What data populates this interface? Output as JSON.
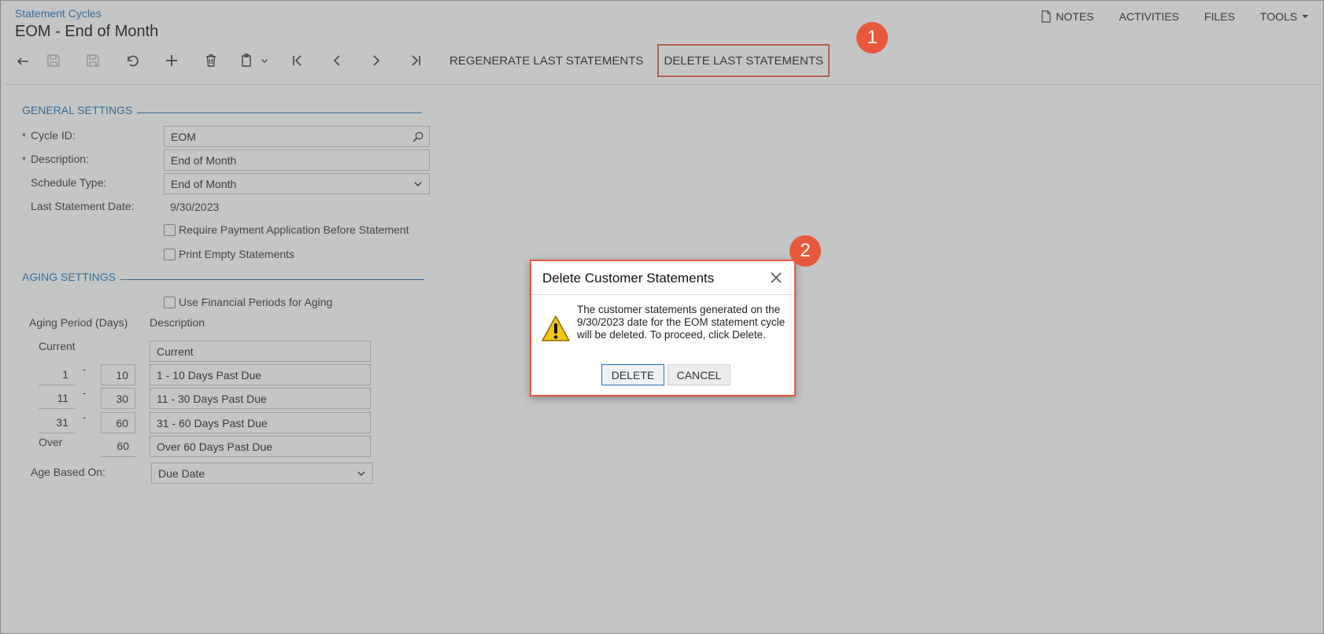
{
  "header": {
    "breadcrumb": "Statement Cycles",
    "title": "EOM - End of Month",
    "links": {
      "notes": "NOTES",
      "activities": "ACTIVITIES",
      "files": "FILES",
      "tools": "TOOLS"
    }
  },
  "toolbar": {
    "regenerate_label": "REGENERATE LAST STATEMENTS",
    "delete_label": "DELETE LAST STATEMENTS",
    "icons": [
      "back-icon",
      "save-close-icon",
      "save-icon",
      "undo-icon",
      "add-icon",
      "delete-icon",
      "copy-paste-icon",
      "first-icon",
      "previous-icon",
      "next-icon",
      "last-icon"
    ]
  },
  "callouts": {
    "one": "1",
    "two": "2",
    "color": "#e8583d"
  },
  "general": {
    "heading": "GENERAL SETTINGS",
    "cycle_id_label": "Cycle ID:",
    "cycle_id_value": "EOM",
    "description_label": "Description:",
    "description_value": "End of Month",
    "schedule_type_label": "Schedule Type:",
    "schedule_type_value": "End of Month",
    "last_statement_label": "Last Statement Date:",
    "last_statement_value": "9/30/2023",
    "require_payment_label": "Require Payment Application Before Statement",
    "print_empty_label": "Print Empty Statements",
    "required_mark": "*"
  },
  "aging": {
    "heading": "AGING SETTINGS",
    "use_fin_periods_label": "Use Financial Periods for Aging",
    "col_period": "Aging Period (Days)",
    "col_description": "Description",
    "dash": "-",
    "rows": [
      {
        "from": "Current",
        "to": "",
        "description": "Current"
      },
      {
        "from": "1",
        "to": "10",
        "description": "1 - 10 Days Past Due"
      },
      {
        "from": "11",
        "to": "30",
        "description": "11 - 30 Days Past Due"
      },
      {
        "from": "31",
        "to": "60",
        "description": "31 - 60 Days Past Due"
      },
      {
        "from": "Over",
        "to": "60",
        "description": "Over 60 Days Past Due"
      }
    ],
    "age_based_label": "Age Based On:",
    "age_based_value": "Due Date"
  },
  "dialog": {
    "title": "Delete Customer Statements",
    "message": "The customer statements generated on the 9/30/2023 date for the EOM statement cycle will be deleted. To proceed, click Delete.",
    "delete_label": "DELETE",
    "cancel_label": "CANCEL"
  }
}
